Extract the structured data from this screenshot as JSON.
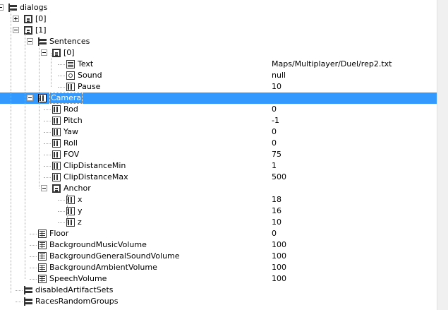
{
  "tree": {
    "rows": [
      {
        "label": "dialogs",
        "value": "",
        "icon": "tree-icon",
        "expander": "minus"
      },
      {
        "label": "[0]",
        "value": "",
        "icon": "array-icon",
        "expander": "plus"
      },
      {
        "label": "[1]",
        "value": "",
        "icon": "array-icon",
        "expander": "minus"
      },
      {
        "label": "Sentences",
        "value": "",
        "icon": "tree-icon",
        "expander": "minus"
      },
      {
        "label": "[0]",
        "value": "",
        "icon": "array-icon",
        "expander": "minus"
      },
      {
        "label": "Text",
        "value": "Maps/Multiplayer/Duel/rep2.txt",
        "icon": "text-icon",
        "expander": ""
      },
      {
        "label": "Sound",
        "value": "null",
        "icon": "sound-icon",
        "expander": ""
      },
      {
        "label": "Pause",
        "value": "10",
        "icon": "number-icon",
        "expander": ""
      },
      {
        "label": "Camera",
        "value": "",
        "icon": "camera-icon",
        "expander": "minus"
      },
      {
        "label": "Rod",
        "value": "0",
        "icon": "number-icon",
        "expander": ""
      },
      {
        "label": "Pitch",
        "value": "-1",
        "icon": "number-icon",
        "expander": ""
      },
      {
        "label": "Yaw",
        "value": "0",
        "icon": "number-icon",
        "expander": ""
      },
      {
        "label": "Roll",
        "value": "0",
        "icon": "number-icon",
        "expander": ""
      },
      {
        "label": "FOV",
        "value": "75",
        "icon": "number-icon",
        "expander": ""
      },
      {
        "label": "ClipDistanceMin",
        "value": "1",
        "icon": "number-icon",
        "expander": ""
      },
      {
        "label": "ClipDistanceMax",
        "value": "500",
        "icon": "number-icon",
        "expander": ""
      },
      {
        "label": "Anchor",
        "value": "",
        "icon": "array-icon",
        "expander": "minus"
      },
      {
        "label": "x",
        "value": "18",
        "icon": "number-icon",
        "expander": ""
      },
      {
        "label": "y",
        "value": "16",
        "icon": "number-icon",
        "expander": ""
      },
      {
        "label": "z",
        "value": "10",
        "icon": "number-icon",
        "expander": ""
      },
      {
        "label": "Floor",
        "value": "0",
        "icon": "object-icon",
        "expander": ""
      },
      {
        "label": "BackgroundMusicVolume",
        "value": "100",
        "icon": "object-icon",
        "expander": ""
      },
      {
        "label": "BackgroundGeneralSoundVolume",
        "value": "100",
        "icon": "object-icon",
        "expander": ""
      },
      {
        "label": "BackgroundAmbientVolume",
        "value": "100",
        "icon": "object-icon",
        "expander": ""
      },
      {
        "label": "SpeechVolume",
        "value": "100",
        "icon": "object-icon",
        "expander": ""
      },
      {
        "label": "disabledArtifactSets",
        "value": "",
        "icon": "tree-icon",
        "expander": ""
      },
      {
        "label": "RacesRandomGroups",
        "value": "",
        "icon": "tree-icon",
        "expander": ""
      }
    ],
    "selected_label": "Camera",
    "colors": {
      "selection": "#3399ff",
      "guide": "#aaaaaa"
    }
  }
}
